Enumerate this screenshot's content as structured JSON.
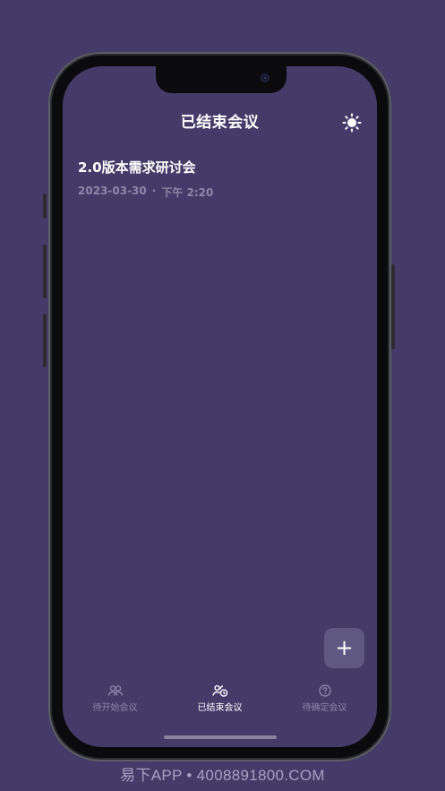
{
  "header": {
    "title": "已结束会议",
    "theme_icon": "sun-icon"
  },
  "meetings": [
    {
      "title": "2.0版本需求研讨会",
      "date": "2023-03-30",
      "separator": "·",
      "time": "下午 2:20"
    }
  ],
  "fab": {
    "label": "+"
  },
  "tabs": [
    {
      "label": "待开始会议",
      "icon": "people-icon",
      "active": false
    },
    {
      "label": "已结束会议",
      "icon": "people-clock-icon",
      "active": true
    },
    {
      "label": "待确定会议",
      "icon": "question-circle-icon",
      "active": false
    }
  ],
  "watermark": "易下APP • 4008891800.COM",
  "colors": {
    "background": "#443b69",
    "fab": "#5f5882",
    "inactive_text": "#8a83a6",
    "meta_text": "#8e87a8"
  }
}
